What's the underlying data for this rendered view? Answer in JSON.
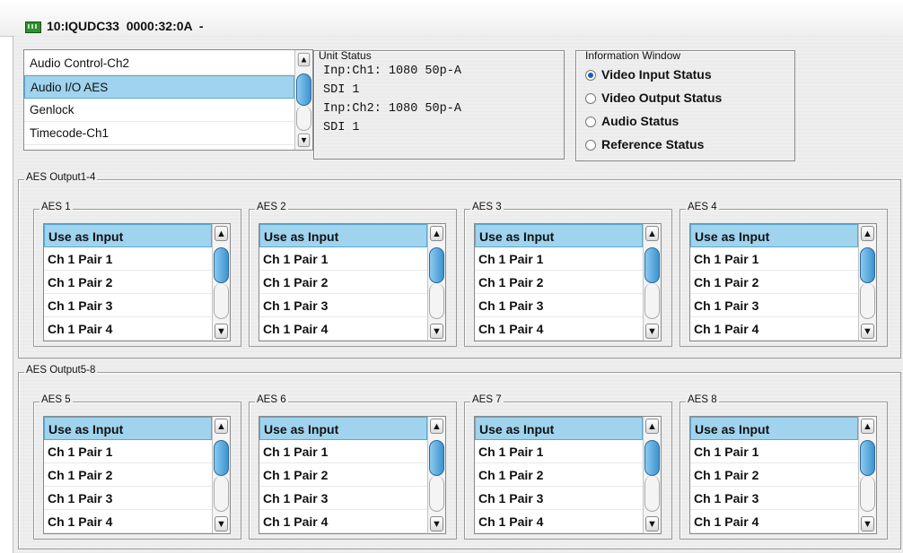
{
  "window": {
    "title": "10:IQUDC33  0000:32:0A  -"
  },
  "menu_list": {
    "items": [
      "Audio Control-Ch2",
      "Audio I/O AES",
      "Genlock",
      "Timecode-Ch1"
    ],
    "selected_index": 1
  },
  "unit_status": {
    "label": "Unit Status",
    "lines": [
      "Inp:Ch1: 1080 50p-A",
      "SDI 1",
      "Inp:Ch2: 1080 50p-A",
      "SDI 1"
    ]
  },
  "info_window": {
    "label": "Information Window",
    "options": [
      "Video Input Status",
      "Video Output Status",
      "Audio Status",
      "Reference Status"
    ],
    "selected_index": 0
  },
  "groups": [
    {
      "label": "AES Output1-4",
      "boxes": [
        {
          "label": "AES 1",
          "items": [
            "Use as Input",
            "Ch 1 Pair 1",
            "Ch 1 Pair 2",
            "Ch 1 Pair 3",
            "Ch 1 Pair 4"
          ]
        },
        {
          "label": "AES 2",
          "items": [
            "Use as Input",
            "Ch 1 Pair 1",
            "Ch 1 Pair 2",
            "Ch 1 Pair 3",
            "Ch 1 Pair 4"
          ]
        },
        {
          "label": "AES 3",
          "items": [
            "Use as Input",
            "Ch 1 Pair 1",
            "Ch 1 Pair 2",
            "Ch 1 Pair 3",
            "Ch 1 Pair 4"
          ]
        },
        {
          "label": "AES 4",
          "items": [
            "Use as Input",
            "Ch 1 Pair 1",
            "Ch 1 Pair 2",
            "Ch 1 Pair 3",
            "Ch 1 Pair 4"
          ]
        }
      ]
    },
    {
      "label": "AES Output5-8",
      "boxes": [
        {
          "label": "AES 5",
          "items": [
            "Use as Input",
            "Ch 1 Pair 1",
            "Ch 1 Pair 2",
            "Ch 1 Pair 3",
            "Ch 1 Pair 4"
          ]
        },
        {
          "label": "AES 6",
          "items": [
            "Use as Input",
            "Ch 1 Pair 1",
            "Ch 1 Pair 2",
            "Ch 1 Pair 3",
            "Ch 1 Pair 4"
          ]
        },
        {
          "label": "AES 7",
          "items": [
            "Use as Input",
            "Ch 1 Pair 1",
            "Ch 1 Pair 2",
            "Ch 1 Pair 3",
            "Ch 1 Pair 4"
          ]
        },
        {
          "label": "AES 8",
          "items": [
            "Use as Input",
            "Ch 1 Pair 1",
            "Ch 1 Pair 2",
            "Ch 1 Pair 3",
            "Ch 1 Pair 4"
          ]
        }
      ]
    }
  ],
  "selected_item_index": 0,
  "colors": {
    "selection": "#9fd3ee",
    "scroll_thumb": "#3b93d0",
    "panel_bg": "#eeeeee"
  },
  "icons": {
    "scroll_up": "▲",
    "scroll_down": "▼",
    "title_icon": "device-card-icon"
  }
}
